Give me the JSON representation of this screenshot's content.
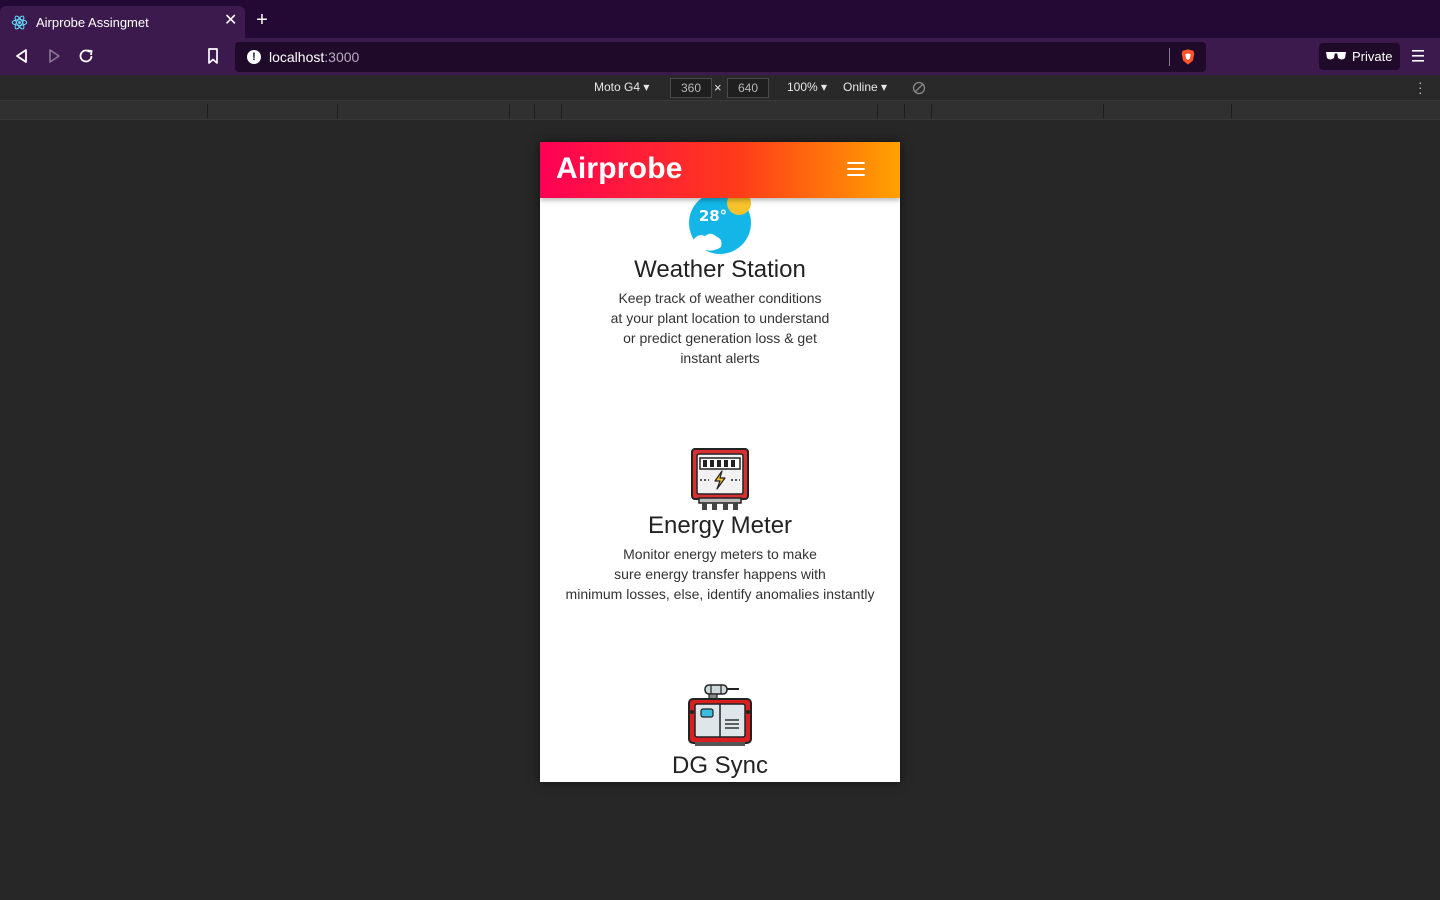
{
  "browser": {
    "tab_title": "Airprobe Assingmet",
    "url_host": "localhost",
    "url_port": ":3000",
    "private_label": "Private"
  },
  "device_toolbar": {
    "device": "Moto G4 ▾",
    "width": "360",
    "height": "640",
    "times": "×",
    "zoom": "100% ▾",
    "network": "Online ▾"
  },
  "app": {
    "brand": "Airprobe",
    "colors": {
      "gradient_start": "#ff0055",
      "gradient_end": "#ffa200"
    },
    "features": [
      {
        "icon": "weather-icon",
        "icon_text": "28°",
        "title": "Weather Station",
        "description": [
          "Keep track of weather conditions",
          "at your plant location to understand",
          "or predict generation loss & get",
          "instant alerts"
        ]
      },
      {
        "icon": "energy-meter-icon",
        "title": "Energy Meter",
        "description": [
          "Monitor energy meters to make",
          "sure energy transfer happens with",
          "minimum losses, else, identify anomalies instantly"
        ]
      },
      {
        "icon": "generator-icon",
        "title": "DG Sync",
        "description": []
      }
    ]
  }
}
